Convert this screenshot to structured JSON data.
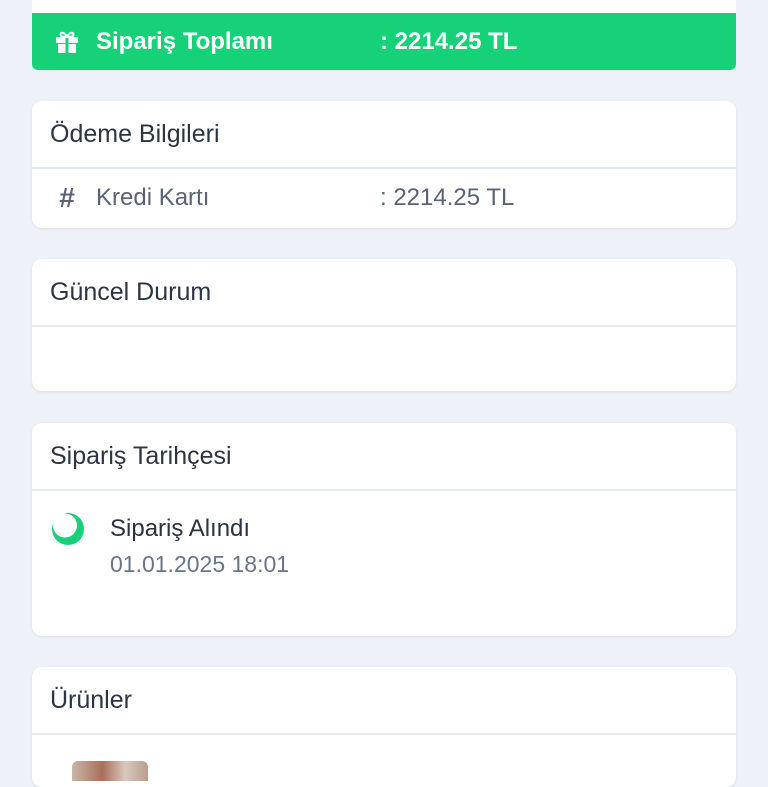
{
  "order_total": {
    "label": "Sipariş Toplamı",
    "value": ": 2214.25 TL",
    "icon": "gift-icon",
    "color": "#16d178"
  },
  "payment": {
    "title": "Ödeme Bilgileri",
    "rows": [
      {
        "icon": "hash-icon",
        "method": "Kredi Kartı",
        "amount": ": 2214.25 TL"
      }
    ]
  },
  "current_status": {
    "title": "Güncel Durum"
  },
  "order_history": {
    "title": "Sipariş Tarihçesi",
    "items": [
      {
        "icon": "status-circle-icon",
        "title": "Sipariş Alındı",
        "date": "01.01.2025 18:01"
      }
    ]
  },
  "products": {
    "title": "Ürünler"
  }
}
